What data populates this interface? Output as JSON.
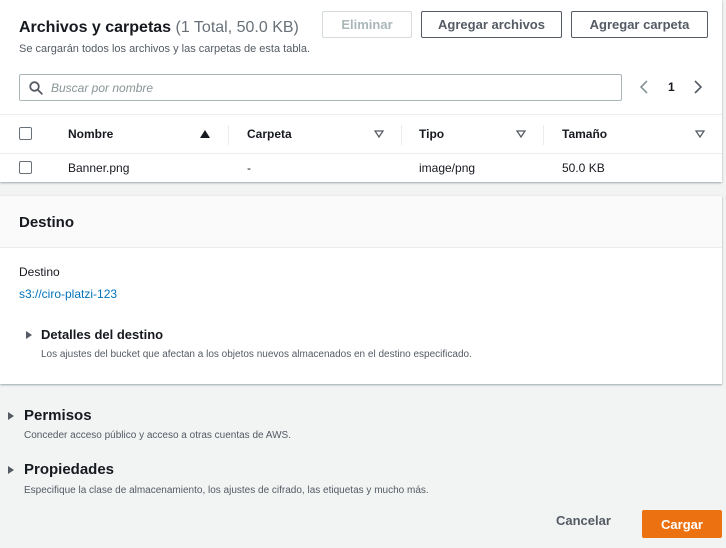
{
  "files": {
    "title": "Archivos y carpetas",
    "count": "(1 Total, 50.0 KB)",
    "subtitle": "Se cargarán todos los archivos y las carpetas de esta tabla.",
    "delete_label": "Eliminar",
    "add_files_label": "Agregar archivos",
    "add_folder_label": "Agregar carpeta",
    "search_placeholder": "Buscar por nombre",
    "page": "1",
    "columns": [
      "Nombre",
      "Carpeta",
      "Tipo",
      "Tamaño"
    ],
    "rows": [
      {
        "name": "Banner.png",
        "folder": "-",
        "type": "image/png",
        "size": "50.0 KB"
      }
    ]
  },
  "destination": {
    "title": "Destino",
    "label": "Destino",
    "uri": "s3://ciro-platzi-123",
    "details_title": "Detalles del destino",
    "details_desc": "Los ajustes del bucket que afectan a los objetos nuevos almacenados en el destino especificado."
  },
  "permissions": {
    "title": "Permisos",
    "desc": "Conceder acceso público y acceso a otras cuentas de AWS."
  },
  "properties": {
    "title": "Propiedades",
    "desc": "Especifique la clase de almacenamiento, los ajustes de cifrado, las etiquetas y mucho más."
  },
  "footer": {
    "cancel_label": "Cancelar",
    "upload_label": "Cargar"
  },
  "colors": {
    "primary": "#ec7211",
    "link": "#0073bb",
    "text": "#16191f",
    "muted": "#545b64",
    "background": "#f2f3f3"
  }
}
